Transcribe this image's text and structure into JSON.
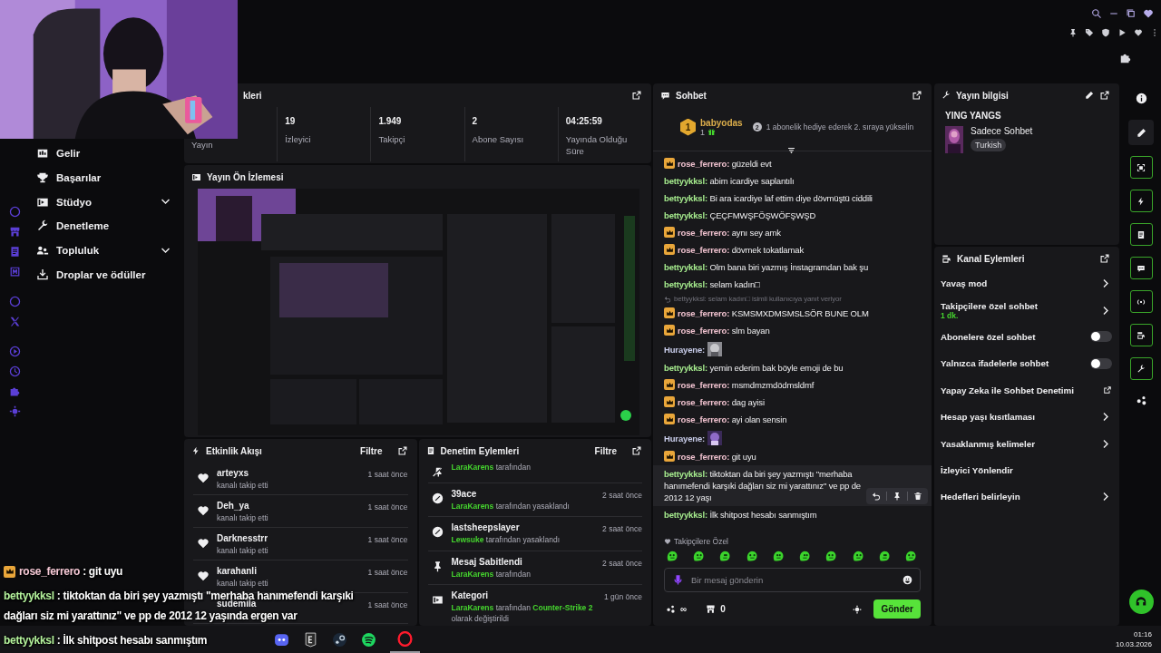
{
  "nav": {
    "items": [
      {
        "label": "Gelir",
        "expandable": false
      },
      {
        "label": "Başarılar",
        "expandable": false
      },
      {
        "label": "Stüdyo",
        "expandable": true
      },
      {
        "label": "Denetleme",
        "expandable": false
      },
      {
        "label": "Topluluk",
        "expandable": true
      },
      {
        "label": "Droplar ve ödüller",
        "expandable": false
      }
    ]
  },
  "stats": {
    "title": "kleri",
    "items": [
      {
        "label": "Yayın"
      },
      {
        "value": "19",
        "label": "İzleyici"
      },
      {
        "value": "1.949",
        "label": "Takipçi"
      },
      {
        "value": "2",
        "label": "Abone Sayısı"
      },
      {
        "value": "04:25:59",
        "label": "Yayında Olduğu Süre"
      }
    ]
  },
  "preview": {
    "title": "Yayın Ön İzlemesi"
  },
  "events": {
    "title": "Etkinlik Akışı",
    "filter": "Filtre",
    "items": [
      {
        "name": "arteyxs",
        "detail": "kanalı takip etti",
        "time": "1 saat önce"
      },
      {
        "name": "Deh_ya",
        "detail": "kanalı takip etti",
        "time": "1 saat önce"
      },
      {
        "name": "Darknesstrr",
        "detail": "kanalı takip etti",
        "time": "1 saat önce"
      },
      {
        "name": "karahanli",
        "detail": "kanalı takip etti",
        "time": "1 saat önce"
      },
      {
        "name": "sudemila",
        "time": "1 saat önce"
      }
    ]
  },
  "moderation": {
    "title": "Denetim Eylemleri",
    "filter": "Filtre",
    "items": [
      {
        "by": "LaraKarens",
        "action": "tarafından"
      },
      {
        "title": "39ace",
        "time": "2 saat önce",
        "by": "LaraKarens",
        "action": "tarafından yasaklandı"
      },
      {
        "title": "lastsheepslayer",
        "time": "2 saat önce",
        "by": "Lewsuke",
        "action": "tarafından yasaklandı"
      },
      {
        "title": "Mesaj Sabitlendi",
        "time": "2 saat önce",
        "by": "LaraKarens",
        "action": "tarafından"
      },
      {
        "title": "Kategori",
        "time": "1 gün önce",
        "by": "LaraKarens",
        "action": "tarafından",
        "target": "Counter-Strike 2",
        "suffix": "olarak değiştirildi"
      }
    ]
  },
  "chat": {
    "title": "Sohbet",
    "top_gifter": {
      "rank": "1",
      "name": "babyodas",
      "count": "1",
      "tier": "2",
      "message": "1 abonelik hediye ederek 2. sıraya yükselin"
    },
    "messages": [
      {
        "kind": "text",
        "badge": true,
        "hovered": false,
        "user": "rose_ferrero:",
        "color": "#f0c2cf",
        "text": "güzeldi evt"
      },
      {
        "kind": "text",
        "badge": false,
        "hovered": false,
        "user": "bettyykksl:",
        "color": "#a6ec8e",
        "text": "abim icardiye saplantılı"
      },
      {
        "kind": "text",
        "badge": false,
        "hovered": false,
        "user": "bettyykksl:",
        "color": "#a6ec8e",
        "text": "Bi ara icardiye laf ettim diye dövmüştü ciddili"
      },
      {
        "kind": "text",
        "badge": false,
        "hovered": false,
        "user": "bettyykksl:",
        "color": "#a6ec8e",
        "text": "ÇEÇFMWŞFÖŞWÖFŞWŞD"
      },
      {
        "kind": "text",
        "badge": true,
        "hovered": false,
        "user": "rose_ferrero:",
        "color": "#f0c2cf",
        "text": "aynı sey amk"
      },
      {
        "kind": "text",
        "badge": true,
        "hovered": false,
        "user": "rose_ferrero:",
        "color": "#f0c2cf",
        "text": "dövmek tokatlamak"
      },
      {
        "kind": "text",
        "badge": false,
        "hovered": false,
        "user": "bettyykksl:",
        "color": "#a6ec8e",
        "text": "Olm bana biri yazmış İnstagramdan bak şu"
      },
      {
        "kind": "text",
        "badge": false,
        "hovered": false,
        "user": "bettyykksl:",
        "color": "#a6ec8e",
        "text": "selam kadın□"
      },
      {
        "kind": "reply",
        "context": "bettyykksl: selam kadın□ isimli kullanıcıya yanıt veriyor"
      },
      {
        "kind": "text",
        "badge": true,
        "hovered": false,
        "user": "rose_ferrero:",
        "color": "#f0c2cf",
        "text": "KSMSMXDMSMSLSÖR BUNE OLM"
      },
      {
        "kind": "text",
        "badge": true,
        "hovered": false,
        "user": "rose_ferrero:",
        "color": "#f0c2cf",
        "text": "slm bayan"
      },
      {
        "kind": "emote",
        "badge": false,
        "hovered": false,
        "user": "Hurayene:",
        "color": "#c9cdea"
      },
      {
        "kind": "text",
        "badge": false,
        "hovered": false,
        "user": "bettyykksl:",
        "color": "#a6ec8e",
        "text": "yemin ederim bak böyle emoji de bu"
      },
      {
        "kind": "text",
        "badge": true,
        "hovered": false,
        "user": "rose_ferrero:",
        "color": "#f0c2cf",
        "text": "msmdmzmdödmsldmf"
      },
      {
        "kind": "text",
        "badge": true,
        "hovered": false,
        "user": "rose_ferrero:",
        "color": "#f0c2cf",
        "text": "dag ayisi"
      },
      {
        "kind": "text",
        "badge": true,
        "hovered": false,
        "user": "rose_ferrero:",
        "color": "#f0c2cf",
        "text": "ayi olan sensin"
      },
      {
        "kind": "emote",
        "badge": false,
        "hovered": false,
        "user": "Hurayene:",
        "color": "#c9cdea"
      },
      {
        "kind": "text",
        "badge": true,
        "hovered": false,
        "user": "rose_ferrero:",
        "color": "#f0c2cf",
        "text": "git uyu"
      },
      {
        "kind": "text",
        "badge": false,
        "hovered": true,
        "user": "bettyykksl:",
        "color": "#a6ec8e",
        "text": "tiktoktan da biri şey yazmıştı \"merhaba hanımefendi karşıki dağları siz mi yarattınız\" ve pp de 2012 12 yaşı"
      },
      {
        "kind": "text",
        "badge": false,
        "hovered": false,
        "user": "bettyykksl:",
        "color": "#a6ec8e",
        "text": "İlk shitpost hesabı sanmıştım"
      }
    ],
    "followers_label": "Takipçilere Özel",
    "input": {
      "placeholder": "Bir mesaj gönderin"
    },
    "points": "∞",
    "store_count": "0",
    "send": "Gönder"
  },
  "stream_info": {
    "title": "Yayın bilgisi",
    "stream_title": "YING YANGS",
    "category": "Sadece Sohbet",
    "tags": [
      "Turkish"
    ]
  },
  "channel_actions": {
    "title": "Kanal Eylemleri",
    "items": [
      {
        "kind": "chevron",
        "label": "Yavaş mod"
      },
      {
        "kind": "chevron",
        "label": "Takipçilere özel sohbet",
        "detail": "1 dk."
      },
      {
        "kind": "toggle",
        "label": "Abonelere özel sohbet",
        "on": false
      },
      {
        "kind": "toggle",
        "label": "Yalnızca ifadelerle sohbet",
        "on": false
      },
      {
        "kind": "external",
        "label": "Yapay Zeka ile Sohbet Denetimi"
      },
      {
        "kind": "chevron",
        "label": "Hesap yaşı kısıtlaması"
      },
      {
        "kind": "chevron",
        "label": "Yasaklanmış kelimeler"
      },
      {
        "kind": "plain",
        "label": "İzleyici Yönlendir"
      },
      {
        "kind": "chevron",
        "label": "Hedefleri belirleyin"
      }
    ]
  },
  "overlay_chat": [
    {
      "badge": true,
      "user": "rose_ferrero",
      "color": "#f6c9d6",
      "lines": [
        ": git uyu"
      ]
    },
    {
      "badge": false,
      "user": "bettyykksl",
      "color": "#b4f29c",
      "lines": [
        ": tiktoktan da biri şey yazmıştı \"merhaba hanımefendi karşıki",
        "dağları siz mi yarattınız\" ve pp de 2012 12 yaşında ergen var"
      ]
    },
    {
      "badge": false,
      "user": "bettyykksl",
      "color": "#b4f29c",
      "lines": [
        ": İlk shitpost hesabı sanmıştım"
      ]
    }
  ],
  "clock": {
    "time": "01:16",
    "date": "10.03.2026"
  }
}
